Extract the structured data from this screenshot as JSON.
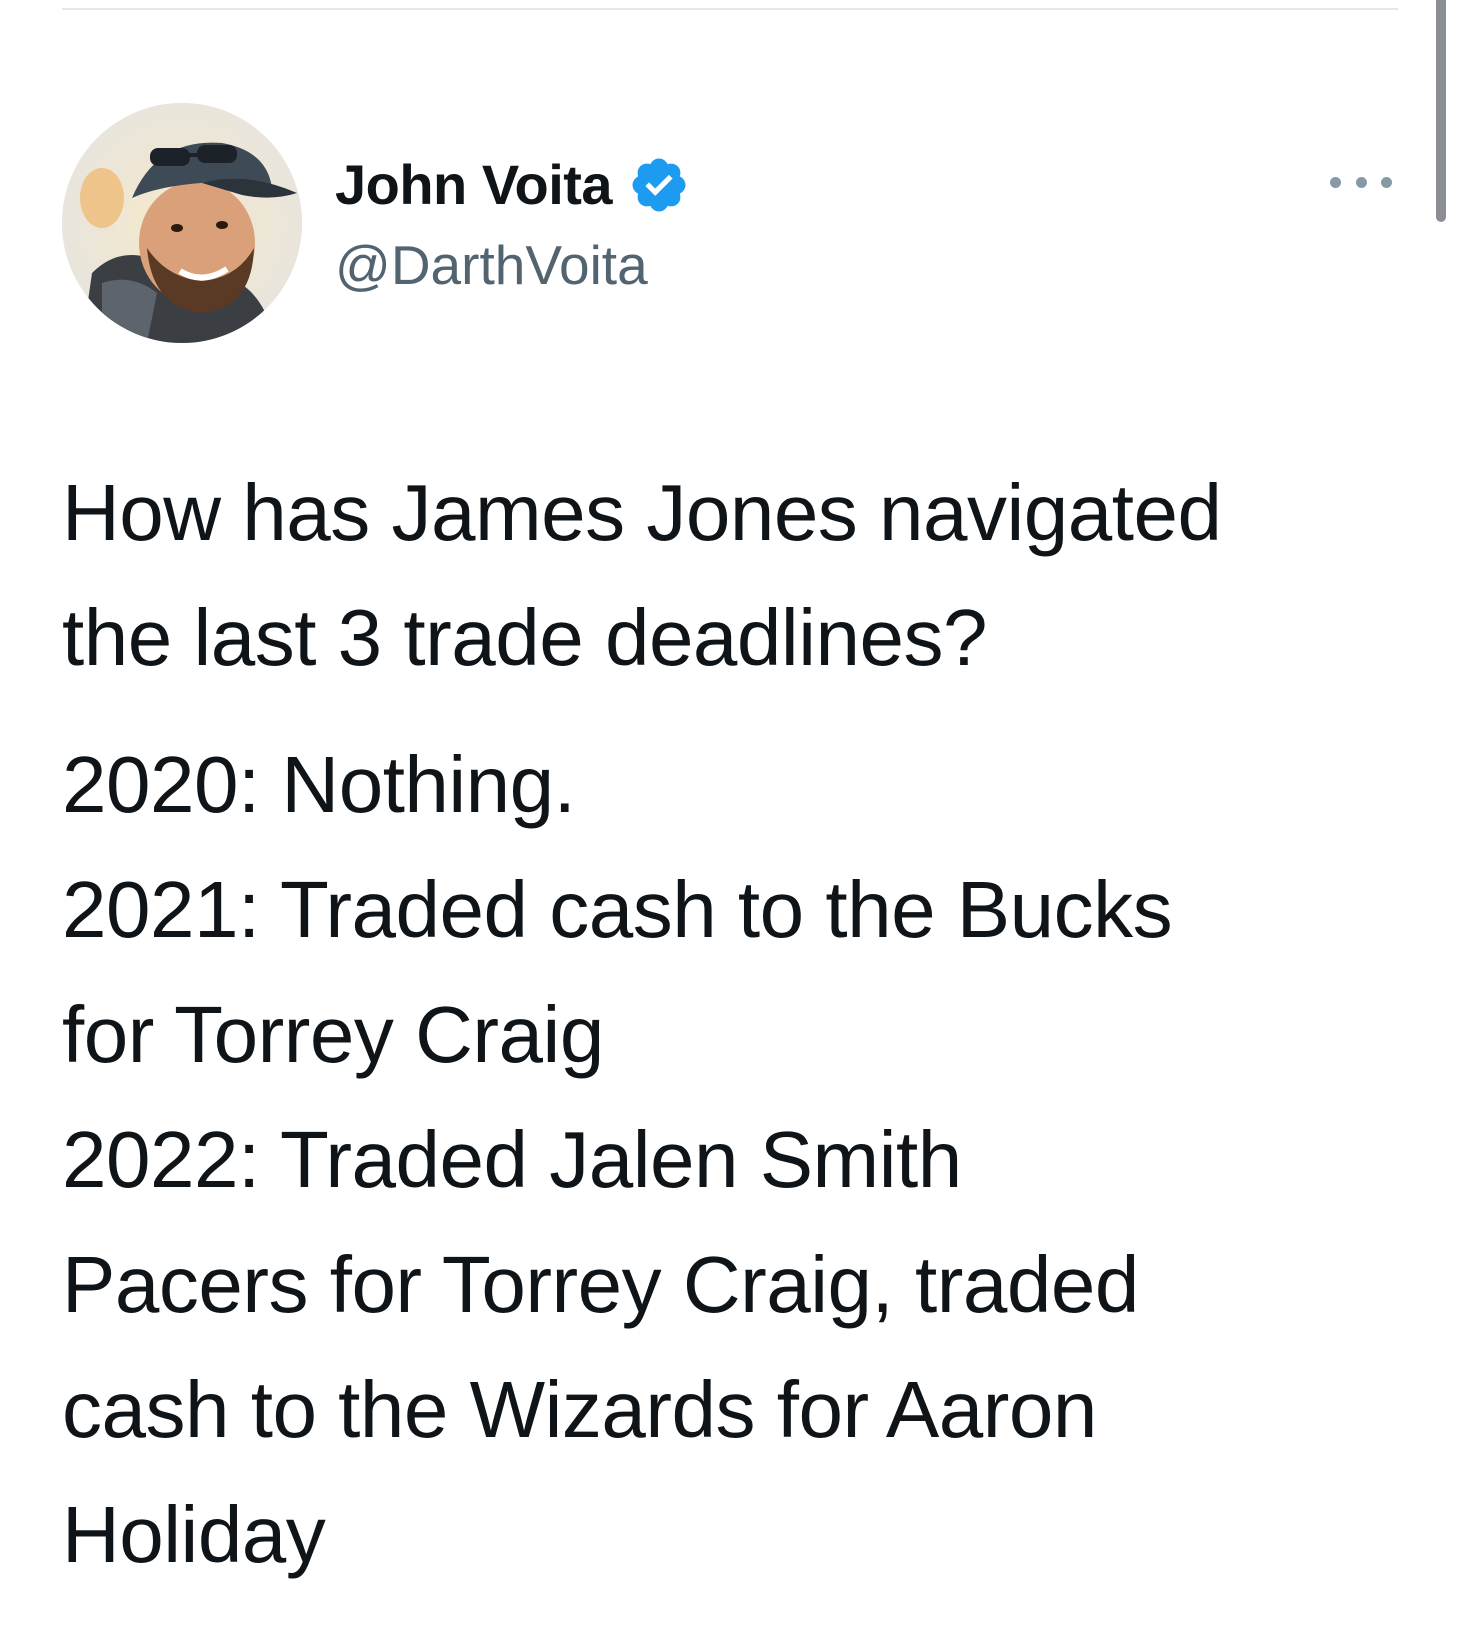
{
  "author": {
    "display_name": "John Voita",
    "handle": "@DarthVoita",
    "verified": true,
    "avatar_icon": "profile-photo-man-with-cap"
  },
  "menu": {
    "icon": "more-horizontal-icon"
  },
  "tweet": {
    "question_lines": [
      "How has James Jones navigated",
      "the last 3 trade deadlines?"
    ],
    "answer_lines": [
      "2020: Nothing.",
      "2021: Traded cash to the Bucks",
      "for Torrey Craig",
      "2022: Traded Jalen Smith",
      "Pacers for Torrey Craig, traded",
      "cash to the Wizards for Aaron",
      "Holiday"
    ]
  },
  "colors": {
    "text": "#0f1419",
    "handle": "#536471",
    "verified_badge": "#1d9bf0",
    "divider": "#e3e8ec"
  }
}
